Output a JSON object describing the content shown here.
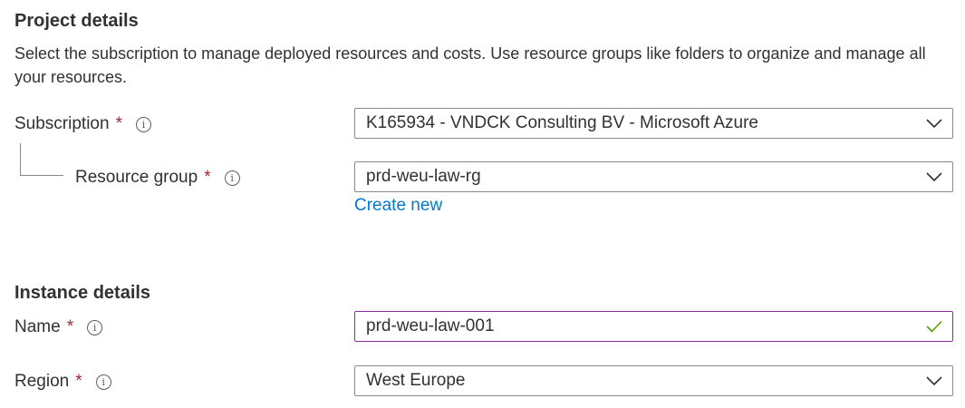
{
  "project": {
    "title": "Project details",
    "description": "Select the subscription to manage deployed resources and costs. Use resource groups like folders to organize and manage all your resources."
  },
  "subscription": {
    "label": "Subscription",
    "required_mark": "*",
    "value": "K165934 - VNDCK Consulting BV - Microsoft Azure"
  },
  "resource_group": {
    "label": "Resource group",
    "required_mark": "*",
    "value": "prd-weu-law-rg",
    "create_new": "Create new"
  },
  "instance": {
    "title": "Instance details"
  },
  "name": {
    "label": "Name",
    "required_mark": "*",
    "value": "prd-weu-law-001"
  },
  "region": {
    "label": "Region",
    "required_mark": "*",
    "value": "West Europe"
  },
  "icons": {
    "info": "info-icon",
    "dropdown": "chevron-down-icon",
    "valid": "checkmark-icon"
  },
  "colors": {
    "required": "#a4262c",
    "link": "#0078d4",
    "focus_border": "#8a2da5",
    "valid_check": "#57a300",
    "border": "#8a8886",
    "text": "#323130"
  },
  "info_glyph": "i"
}
